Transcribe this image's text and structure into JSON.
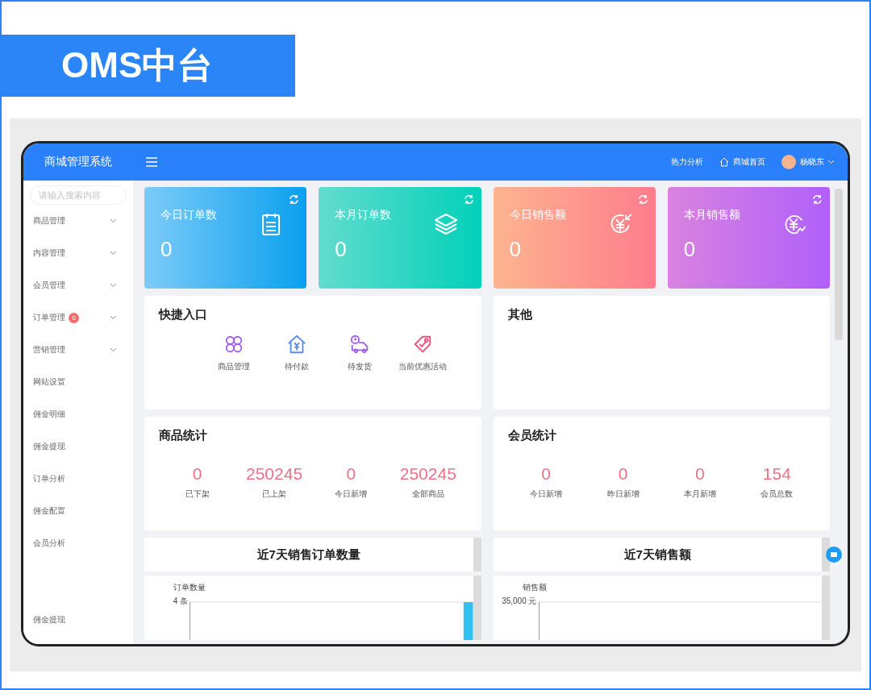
{
  "banner": {
    "title": "OMS中台"
  },
  "header": {
    "brand": "商城管理系统",
    "links": [
      {
        "label": "热力分析",
        "kind": "text"
      },
      {
        "label": "商城首页",
        "kind": "home"
      }
    ],
    "user": "杨晓东"
  },
  "sidebar": {
    "search": {
      "placeholder": "请输入搜索内容"
    },
    "items": [
      {
        "label": "商品管理",
        "submenu": true
      },
      {
        "label": "内容管理",
        "submenu": true
      },
      {
        "label": "会员管理",
        "submenu": true
      },
      {
        "label": "订单管理",
        "submenu": true,
        "badge": "0"
      },
      {
        "label": "营销管理",
        "submenu": true
      },
      {
        "label": "网站设置",
        "submenu": false
      },
      {
        "label": "佣金明细",
        "submenu": false
      },
      {
        "label": "佣金提现",
        "submenu": false
      },
      {
        "label": "订单分析",
        "submenu": false
      },
      {
        "label": "佣金配置",
        "submenu": false
      },
      {
        "label": "会员分析",
        "submenu": false
      }
    ],
    "bottom_item": "佣金提现"
  },
  "stat_cards": [
    {
      "title": "今日订单数",
      "value": "0",
      "kind": "clipboard"
    },
    {
      "title": "本月订单数",
      "value": "0",
      "kind": "layers"
    },
    {
      "title": "今日销售额",
      "value": "0",
      "kind": "yen-in"
    },
    {
      "title": "本月销售额",
      "value": "0",
      "kind": "yen-trend"
    }
  ],
  "quick_entry": {
    "title": "快捷入口",
    "items": [
      {
        "label": "商品管理",
        "kind": "grid"
      },
      {
        "label": "待付款",
        "kind": "house"
      },
      {
        "label": "待发货",
        "kind": "truck"
      },
      {
        "label": "当前优惠活动",
        "kind": "tag"
      }
    ]
  },
  "other": {
    "title": "其他"
  },
  "product_stats": {
    "title": "商品统计",
    "items": [
      {
        "value": "0",
        "label": "已下架"
      },
      {
        "value": "250245",
        "label": "已上架"
      },
      {
        "value": "0",
        "label": "今日新增"
      },
      {
        "value": "250245",
        "label": "全部商品"
      }
    ]
  },
  "member_stats": {
    "title": "会员统计",
    "items": [
      {
        "value": "0",
        "label": "今日新增"
      },
      {
        "value": "0",
        "label": "昨日新增"
      },
      {
        "value": "0",
        "label": "本月新增"
      },
      {
        "value": "154",
        "label": "会员总数"
      }
    ]
  },
  "charts": [
    {
      "title": "近7天销售订单数量",
      "axis_label": "订单数量",
      "top_tick": "4 条",
      "kind": "bar"
    },
    {
      "title": "近7天销售额",
      "axis_label": "销售额",
      "top_tick": "35,000 元",
      "kind": "line"
    }
  ]
}
